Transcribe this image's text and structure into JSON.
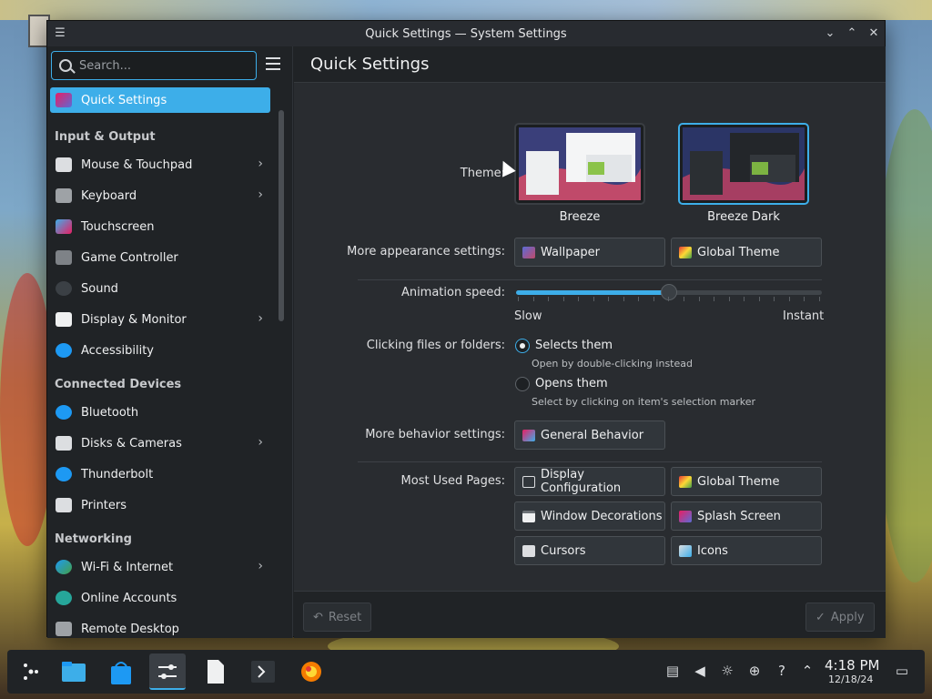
{
  "window": {
    "title": "Quick Settings — System Settings",
    "buttons": {
      "minimize": "chevron-down-icon",
      "maximize": "chevron-up-icon",
      "close": "close-icon"
    }
  },
  "sidebar": {
    "search": {
      "placeholder": "Search...",
      "value": ""
    },
    "items": [
      {
        "type": "item",
        "label": "Quick Settings",
        "icon": "quick-settings-icon",
        "active": true,
        "chevron": false
      },
      {
        "type": "section",
        "label": "Input & Output"
      },
      {
        "type": "item",
        "label": "Mouse & Touchpad",
        "icon": "mouse-icon",
        "chevron": true
      },
      {
        "type": "item",
        "label": "Keyboard",
        "icon": "keyboard-icon",
        "chevron": true
      },
      {
        "type": "item",
        "label": "Touchscreen",
        "icon": "touchscreen-icon",
        "chevron": false
      },
      {
        "type": "item",
        "label": "Game Controller",
        "icon": "gamepad-icon",
        "chevron": false
      },
      {
        "type": "item",
        "label": "Sound",
        "icon": "speaker-icon",
        "chevron": false
      },
      {
        "type": "item",
        "label": "Display & Monitor",
        "icon": "monitor-icon",
        "chevron": true
      },
      {
        "type": "item",
        "label": "Accessibility",
        "icon": "accessibility-icon",
        "chevron": false
      },
      {
        "type": "section",
        "label": "Connected Devices"
      },
      {
        "type": "item",
        "label": "Bluetooth",
        "icon": "bluetooth-icon",
        "chevron": false
      },
      {
        "type": "item",
        "label": "Disks & Cameras",
        "icon": "disk-icon",
        "chevron": true
      },
      {
        "type": "item",
        "label": "Thunderbolt",
        "icon": "thunderbolt-icon",
        "chevron": false
      },
      {
        "type": "item",
        "label": "Printers",
        "icon": "printer-icon",
        "chevron": false
      },
      {
        "type": "section",
        "label": "Networking"
      },
      {
        "type": "item",
        "label": "Wi-Fi & Internet",
        "icon": "globe-icon",
        "chevron": true
      },
      {
        "type": "item",
        "label": "Online Accounts",
        "icon": "online-accounts-icon",
        "chevron": false
      },
      {
        "type": "item",
        "label": "Remote Desktop",
        "icon": "remote-desktop-icon",
        "chevron": false
      }
    ]
  },
  "main": {
    "page_title": "Quick Settings",
    "theme": {
      "label": "Theme:",
      "options": [
        {
          "name": "Breeze",
          "selected": false
        },
        {
          "name": "Breeze Dark",
          "selected": true
        }
      ]
    },
    "appearance": {
      "label": "More appearance settings:",
      "wallpaper": "Wallpaper",
      "global_theme": "Global Theme"
    },
    "animation": {
      "label": "Animation speed:",
      "min_label": "Slow",
      "max_label": "Instant",
      "value_fraction": 0.5
    },
    "clicking": {
      "label": "Clicking files or folders:",
      "option1": "Selects them",
      "option1_sub": "Open by double-clicking instead",
      "option2": "Opens them",
      "option2_sub": "Select by clicking on item's selection marker",
      "selected": "option1"
    },
    "behavior": {
      "label": "More behavior settings:",
      "general": "General Behavior"
    },
    "most_used": {
      "label": "Most Used Pages:",
      "pages": [
        "Display Configuration",
        "Global Theme",
        "Window Decorations",
        "Splash Screen",
        "Cursors",
        "Icons"
      ]
    },
    "footer": {
      "reset": "Reset",
      "apply": "Apply"
    }
  },
  "taskbar": {
    "items": [
      "app-launcher-icon",
      "file-manager-icon",
      "discover-icon",
      "system-settings-icon",
      "document-icon",
      "konsole-icon",
      "browser-icon"
    ],
    "tray": [
      "clipboard-icon",
      "volume-muted-icon",
      "brightness-icon",
      "network-icon",
      "help-icon",
      "chevron-up-icon"
    ],
    "time": "4:18 PM",
    "date": "12/18/24",
    "show_desktop": "show-desktop-icon"
  },
  "colors": {
    "accent": "#3daee9",
    "window_bg": "#202326",
    "content_bg": "#292c30"
  }
}
